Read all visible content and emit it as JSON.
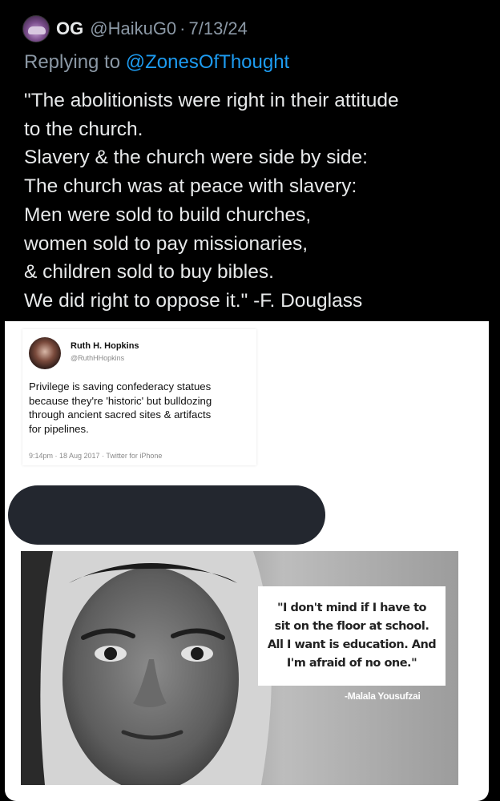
{
  "tweet": {
    "display_name": "OG",
    "handle": "@HaikuG0",
    "separator": "·",
    "date": "7/13/24",
    "avatar_icon": "profile-avatar",
    "reply_prefix": "Replying to",
    "reply_mention": "@ZonesOfThought",
    "text_lines": [
      "\"The abolitionists were right in their attitude",
      "to the church.",
      "Slavery & the church were side by side:",
      "The church was at peace with slavery:",
      "Men were sold to build churches,",
      "women sold to pay missionaries,",
      "& children sold to buy bibles.",
      "We did right to oppose it.\" -F. Douglass"
    ]
  },
  "embedded_tweet": {
    "name": "Ruth H. Hopkins",
    "handle": "@RuthHHopkins",
    "text_lines": [
      "Privilege is saving confederacy statues",
      "because they're 'historic' but bulldozing",
      "through ancient sacred sites & artifacts",
      "for pipelines."
    ],
    "meta": "9:14pm · 18 Aug 2017 · Twitter for iPhone"
  },
  "quote_image": {
    "quote_lines": [
      "\"I don't mind if I have to",
      "sit on the floor at school.",
      "All I want is education. And",
      "I'm afraid of no one.\""
    ],
    "attribution": "-Malala Yousufzai"
  },
  "colors": {
    "background": "#000000",
    "text_primary": "#e7e9ea",
    "text_secondary": "#8b98a5",
    "link": "#1d9bf0",
    "redaction": "#23272f"
  }
}
